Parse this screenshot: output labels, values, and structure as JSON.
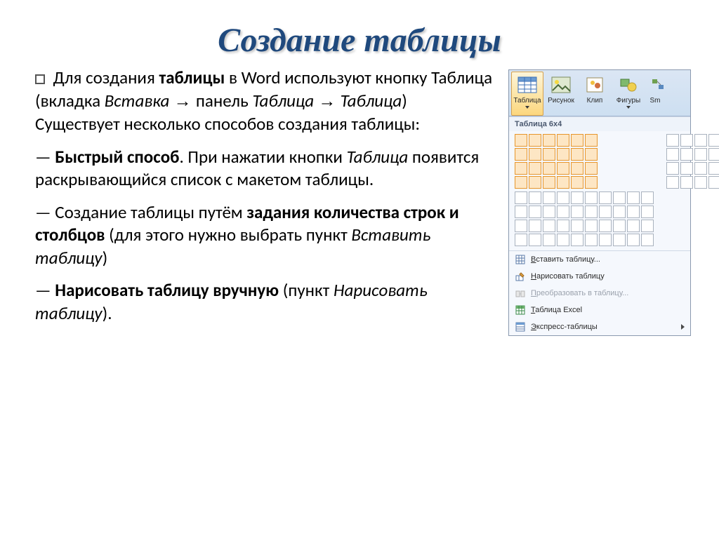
{
  "title": "Создание таблицы",
  "para1": {
    "t1": "Для создания ",
    "b1": "таблицы ",
    "t2": "в Word используют кнопку Таблица (вкладка ",
    "i1": "Вставка",
    "t3": " панель ",
    "i2": "Таблица",
    "t4": "  ",
    "i3": "Таблица",
    "t5": ") Существует несколько способов создания таблицы:"
  },
  "para2": {
    "t1": "— ",
    "b1": "Быстрый способ",
    "t2": ". При нажатии кнопки ",
    "i1": "Таблица ",
    "t3": " появится раскрывающийся список с макетом таблицы."
  },
  "para3": {
    "t1": "— Создание таблицы путём ",
    "b1": "задания количества строк и столбцов ",
    "t2": "(для этого нужно выбрать пункт ",
    "i1": "Вставить таблицу",
    "t3": ")"
  },
  "para4": {
    "t1": "— ",
    "b1": "Нарисовать таблицу вручную ",
    "t2": "(пункт ",
    "i1": "Нарисовать таблицу",
    "t3": ")."
  },
  "ribbon": {
    "table": "Таблица",
    "picture": "Рисунок",
    "clip": "Клип",
    "shapes": "Фигуры",
    "smart": "Sm"
  },
  "dropdown": {
    "header": "Таблица 6x4",
    "menu": {
      "insert": "Вставить таблицу...",
      "draw": "Нарисовать таблицу",
      "convert": "Преобразовать в таблицу...",
      "excel": "Таблица Excel",
      "quick": "Экспресс-таблицы",
      "u_insert": "В",
      "u_draw": "Н",
      "u_convert": "П",
      "u_excel": "Т",
      "u_quick": "Э"
    }
  }
}
